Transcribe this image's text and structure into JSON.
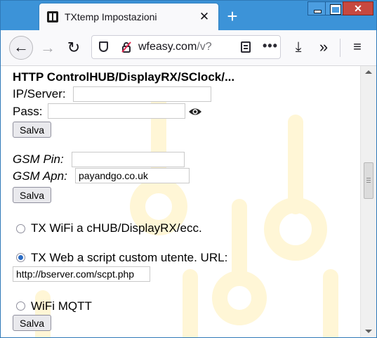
{
  "browser": {
    "tab_title": "TXtemp Impostazioni",
    "tab_close": "✕",
    "new_tab": "+",
    "url_domain": "wfeasy.com",
    "url_path": "/v?",
    "url_more": "•••",
    "overflow_glyph": "»",
    "menu_glyph": "≡",
    "download_glyph": "⤓"
  },
  "nav": {
    "back": "←",
    "forward": "→",
    "reload": "↻"
  },
  "window": {
    "close": "✕"
  },
  "page": {
    "heading": "HTTP ControlHUB/DisplayRX/SClock/...",
    "ip_label": "IP/Server:",
    "ip_value": "",
    "pass_label": "Pass:",
    "pass_value": "",
    "save_label": "Salva",
    "gsm_pin_label": "GSM Pin:",
    "gsm_pin_value": "",
    "gsm_apn_label": "GSM Apn:",
    "gsm_apn_value": "payandgo.co.uk",
    "radio_options": [
      {
        "label": "TX WiFi a cHUB/DisplayRX/ecc.",
        "checked": false
      },
      {
        "label": "TX Web a script custom utente. URL:",
        "checked": true
      },
      {
        "label": "WiFi MQTT",
        "checked": false
      }
    ],
    "script_url_value": "http://bserver.com/scpt.php"
  },
  "colors": {
    "titlebar": "#3c93d8",
    "radio_selected": "#2b6cc4",
    "watermark": "#fff6d6"
  },
  "scrollbar": {
    "position_fraction": 0.4
  }
}
